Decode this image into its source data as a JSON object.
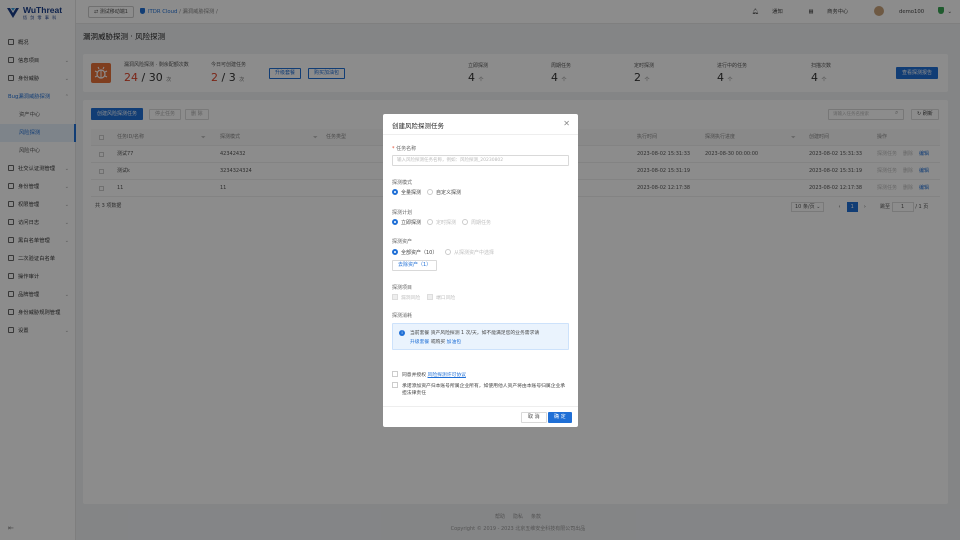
{
  "brand": {
    "name": "WuThreat",
    "sub": "悟 剑 零 事 科"
  },
  "topbar": {
    "workspace_btn": "测试移动端1",
    "crumb_org": "ITDR Cloud",
    "crumb_sep": "/",
    "crumb_page": "漏洞威胁探测",
    "crumb_sep2": "/",
    "notice": "通知",
    "orders": "商务中心",
    "user": "demo100"
  },
  "sidebar": {
    "items": [
      {
        "label": "概况"
      },
      {
        "label": "信息项目"
      },
      {
        "label": "身份威胁"
      },
      {
        "label": "Bug漏洞威胁探测"
      },
      {
        "label": "资产中心"
      },
      {
        "label": "风险探测"
      },
      {
        "label": "风险中心"
      },
      {
        "label": "社交认证测管理"
      },
      {
        "label": "身份管理"
      },
      {
        "label": "权限管理"
      },
      {
        "label": "访问日志"
      },
      {
        "label": "黑白名单管理"
      },
      {
        "label": "二次验证白名单"
      },
      {
        "label": "操作审计"
      },
      {
        "label": "品牌管理"
      },
      {
        "label": "身份威胁规则管理"
      },
      {
        "label": "设置"
      }
    ]
  },
  "page": {
    "title": "漏洞威胁探测 · 风险探测"
  },
  "stats": {
    "remain_label": "漏洞风险探测 · 剩余配额次数",
    "remain_used": "24",
    "remain_total": "/ 30",
    "remain_unit": "次",
    "today_label": "今日可创建任务",
    "today_used": "2",
    "today_total": "/ 3",
    "today_unit": "次",
    "upgrade_btn": "升级套餐",
    "buy_btn": "购买加油包",
    "immediate_label": "立即探测",
    "immediate_val": "4",
    "immediate_unit": "个",
    "periodic_label": "周期任务",
    "periodic_val": "4",
    "periodic_unit": "个",
    "scheduled_label": "定时探测",
    "scheduled_val": "2",
    "scheduled_unit": "个",
    "running_label": "进行中的任务",
    "running_val": "4",
    "running_unit": "个",
    "scan_label": "扫描次数",
    "scan_val": "4",
    "scan_unit": "个",
    "report_btn": "查看探测报告"
  },
  "toolbar": {
    "create_btn": "创建风险探测任务",
    "start_btn": "停止任务",
    "delete_btn": "删 除",
    "search_placeholder": "请输入任务名搜索",
    "refresh_btn": "刷新"
  },
  "table": {
    "headers": [
      "任务ID/名称",
      "探测模式",
      "任务类型",
      "执行时间",
      "探测执行进度",
      "创建时间",
      "操作"
    ],
    "rows": [
      {
        "name": "测试77",
        "mode": "42342432",
        "type": "",
        "exec": "2023-08-02 15:31:33",
        "progress": "2023-08-30 00:00:00",
        "created": "2023-08-02 15:31:33",
        "ops": [
          "探测任务",
          "删除",
          "编辑"
        ]
      },
      {
        "name": "测试k",
        "mode": "3234324324",
        "type": "",
        "exec": "2023-08-02 15:31:19",
        "progress": "",
        "created": "2023-08-02 15:31:19",
        "ops": [
          "探测任务",
          "删除",
          "编辑"
        ]
      },
      {
        "name": "11",
        "mode": "11",
        "type": "",
        "exec": "2023-08-02 12:17:38",
        "progress": "",
        "created": "2023-08-02 12:17:38",
        "ops": [
          "探测任务",
          "删除",
          "编辑"
        ]
      }
    ],
    "total": "共 3 项数据",
    "page_size": "10 条/页",
    "current_page": "1",
    "jump_label": "跳至",
    "jump_val": "1",
    "page_suffix": "/ 1 页"
  },
  "footer": {
    "links": [
      "帮助",
      "隐私",
      "条款"
    ],
    "copyright": "Copyright © 2019 - 2023 北京五维安全科技有限公司出品"
  },
  "modal": {
    "title": "创建风险探测任务",
    "name_label": "任务名称",
    "name_placeholder": "输入风险探测任务名称，例如：风险探测_20230802",
    "mode_label": "探测模式",
    "mode_opts": [
      "全量探测",
      "自定义探测"
    ],
    "plan_label": "探测计划",
    "plan_opts": [
      "立即探测",
      "定时探测",
      "周期任务"
    ],
    "asset_label": "探测资产",
    "asset_opts": [
      "全部资产（10）",
      "从探测资产中选择"
    ],
    "asset_btn": "去除资产（1）",
    "item_label": "探测项目",
    "item_opts": [
      "漏洞风险",
      "端口风险"
    ],
    "consume_label": "探测消耗",
    "notice_line1": "当前套餐 资产风险探测 1 次/天，如不能满足您的业务需求请",
    "notice_upgrade": "升级套餐",
    "notice_or": "或购买",
    "notice_buy": "加油包",
    "agree1_pre": "同意并授权",
    "agree1_link": "风险探测许可协议",
    "agree2": "承诺添加资产归本账号所属企业所有，如使用他人资产将由本账号归属企业承担法律责任",
    "cancel": "取 消",
    "ok": "确 定"
  }
}
